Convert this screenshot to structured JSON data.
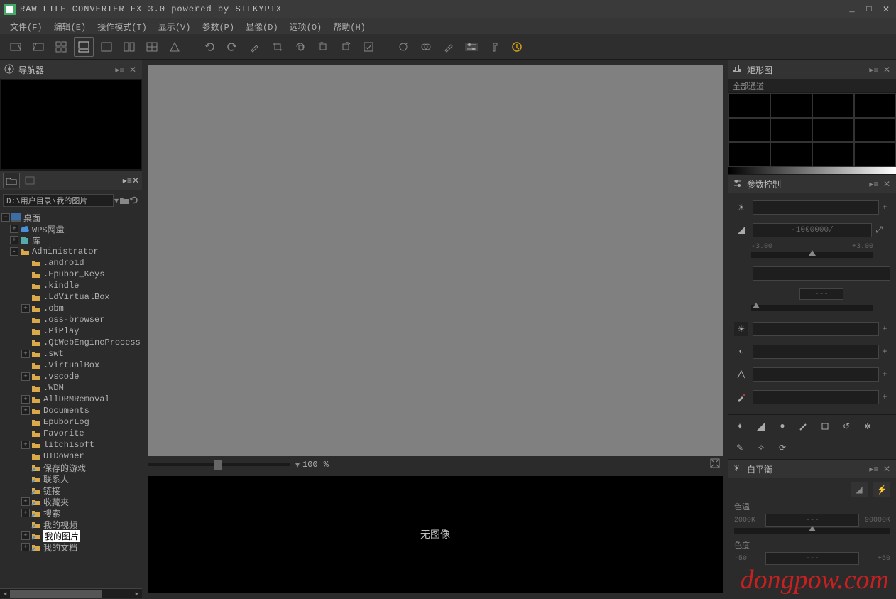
{
  "title": "RAW FILE CONVERTER EX 3.0 powered by SILKYPIX",
  "menu": [
    {
      "label": "文件(F)"
    },
    {
      "label": "编辑(E)"
    },
    {
      "label": "操作模式(T)"
    },
    {
      "label": "显示(V)"
    },
    {
      "label": "参数(P)"
    },
    {
      "label": "显像(D)"
    },
    {
      "label": "选项(O)"
    },
    {
      "label": "帮助(H)"
    }
  ],
  "nav": {
    "title": "导航器"
  },
  "path": "D:\\用户目录\\我的图片",
  "tree_root": "桌面",
  "tree": [
    {
      "d": 0,
      "exp": "+",
      "icon": "cloud",
      "label": "WPS网盘"
    },
    {
      "d": 0,
      "exp": "+",
      "icon": "lib",
      "label": "库"
    },
    {
      "d": 0,
      "exp": "-",
      "icon": "user",
      "label": "Administrator"
    },
    {
      "d": 1,
      "exp": "",
      "icon": "folder",
      "label": ".android"
    },
    {
      "d": 1,
      "exp": "",
      "icon": "folder",
      "label": ".Epubor_Keys"
    },
    {
      "d": 1,
      "exp": "",
      "icon": "folder",
      "label": ".kindle"
    },
    {
      "d": 1,
      "exp": "",
      "icon": "folder",
      "label": ".LdVirtualBox"
    },
    {
      "d": 1,
      "exp": "+",
      "icon": "folder",
      "label": ".obm"
    },
    {
      "d": 1,
      "exp": "",
      "icon": "folder",
      "label": ".oss-browser"
    },
    {
      "d": 1,
      "exp": "",
      "icon": "folder",
      "label": ".PiPlay"
    },
    {
      "d": 1,
      "exp": "",
      "icon": "folder",
      "label": ".QtWebEngineProcess"
    },
    {
      "d": 1,
      "exp": "+",
      "icon": "folder",
      "label": ".swt"
    },
    {
      "d": 1,
      "exp": "",
      "icon": "folder",
      "label": ".VirtualBox"
    },
    {
      "d": 1,
      "exp": "+",
      "icon": "folder",
      "label": ".vscode"
    },
    {
      "d": 1,
      "exp": "",
      "icon": "folder",
      "label": ".WDM"
    },
    {
      "d": 1,
      "exp": "+",
      "icon": "folder",
      "label": "AllDRMRemoval"
    },
    {
      "d": 1,
      "exp": "+",
      "icon": "folder",
      "label": "Documents"
    },
    {
      "d": 1,
      "exp": "",
      "icon": "folder",
      "label": "EpuborLog"
    },
    {
      "d": 1,
      "exp": "",
      "icon": "folder",
      "label": "Favorite"
    },
    {
      "d": 1,
      "exp": "+",
      "icon": "folder",
      "label": "litchisoft"
    },
    {
      "d": 1,
      "exp": "",
      "icon": "folder",
      "label": "UIDowner"
    },
    {
      "d": 1,
      "exp": "",
      "icon": "link",
      "label": "保存的游戏"
    },
    {
      "d": 1,
      "exp": "",
      "icon": "link",
      "label": "联系人"
    },
    {
      "d": 1,
      "exp": "",
      "icon": "link",
      "label": "链接"
    },
    {
      "d": 1,
      "exp": "+",
      "icon": "link",
      "label": "收藏夹"
    },
    {
      "d": 1,
      "exp": "+",
      "icon": "link",
      "label": "搜索"
    },
    {
      "d": 1,
      "exp": "",
      "icon": "link",
      "label": "我的视频"
    },
    {
      "d": 1,
      "exp": "+",
      "icon": "link",
      "label": "我的图片",
      "selected": true
    },
    {
      "d": 1,
      "exp": "+",
      "icon": "link",
      "label": "我的文档"
    }
  ],
  "zoom": {
    "value": "100",
    "unit": "%"
  },
  "no_image": "无图像",
  "histogram": {
    "title": "矩形图",
    "channel": "全部通道"
  },
  "params": {
    "title": "参数控制",
    "exposure_value": "-1000000/",
    "exposure_min": "-3.00",
    "exposure_max": "+3.00",
    "placeholder": "---"
  },
  "wb": {
    "title": "白平衡",
    "temp_label": "色温",
    "temp_min": "2000K",
    "temp_max": "90000K",
    "temp_val": "---",
    "tint_label": "色度",
    "tint_min": "-50",
    "tint_max": "+50",
    "tint_val": "---"
  },
  "watermark": "dongpow.com"
}
